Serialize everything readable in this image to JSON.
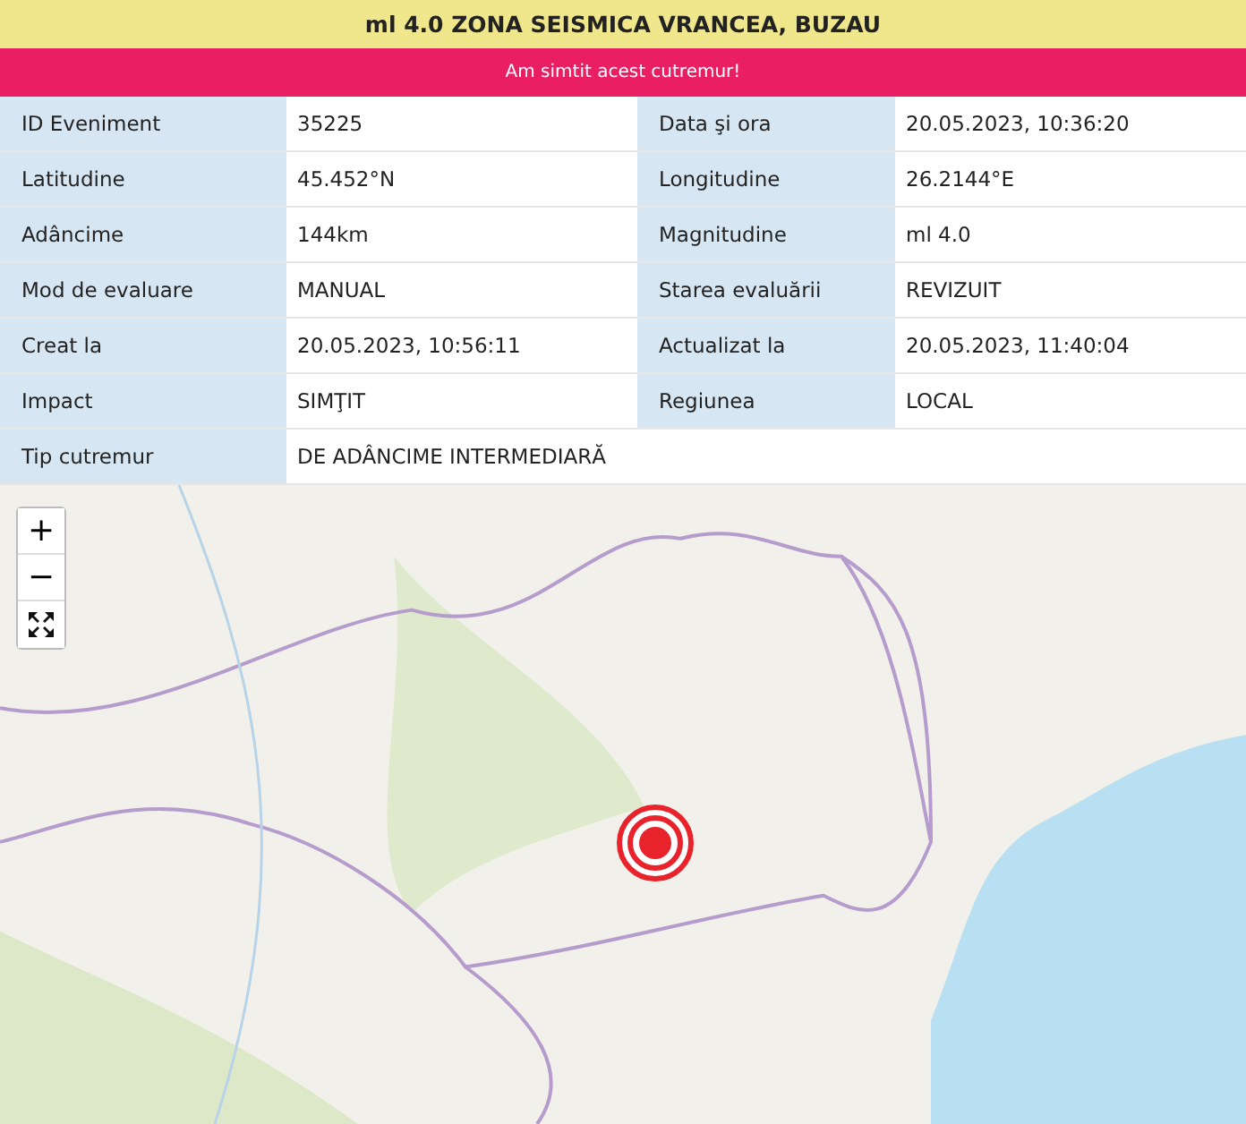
{
  "title": "ml 4.0 ZONA SEISMICA VRANCEA, BUZAU",
  "banner": "Am simtit acest cutremur!",
  "rows": [
    [
      {
        "label": "ID Eveniment",
        "value": "35225"
      },
      {
        "label": "Data şi ora",
        "value": "20.05.2023, 10:36:20"
      }
    ],
    [
      {
        "label": "Latitudine",
        "value": "45.452°N"
      },
      {
        "label": "Longitudine",
        "value": "26.2144°E"
      }
    ],
    [
      {
        "label": "Adâncime",
        "value": "144km"
      },
      {
        "label": "Magnitudine",
        "value": "ml 4.0"
      }
    ],
    [
      {
        "label": "Mod de evaluare",
        "value": "MANUAL"
      },
      {
        "label": "Starea evaluării",
        "value": "REVIZUIT"
      }
    ],
    [
      {
        "label": "Creat la",
        "value": "20.05.2023, 10:56:11"
      },
      {
        "label": "Actualizat la",
        "value": "20.05.2023, 11:40:04"
      }
    ],
    [
      {
        "label": "Impact",
        "value": "SIMŢIT"
      },
      {
        "label": "Regiunea",
        "value": "LOCAL"
      }
    ],
    [
      {
        "label": "Tip cutremur",
        "value": "DE ADÂNCIME INTERMEDIARĂ"
      }
    ]
  ],
  "map": {
    "controls": [
      {
        "kind": "text",
        "label": "+"
      },
      {
        "kind": "text",
        "label": "−"
      },
      {
        "kind": "fullscreen"
      }
    ]
  }
}
